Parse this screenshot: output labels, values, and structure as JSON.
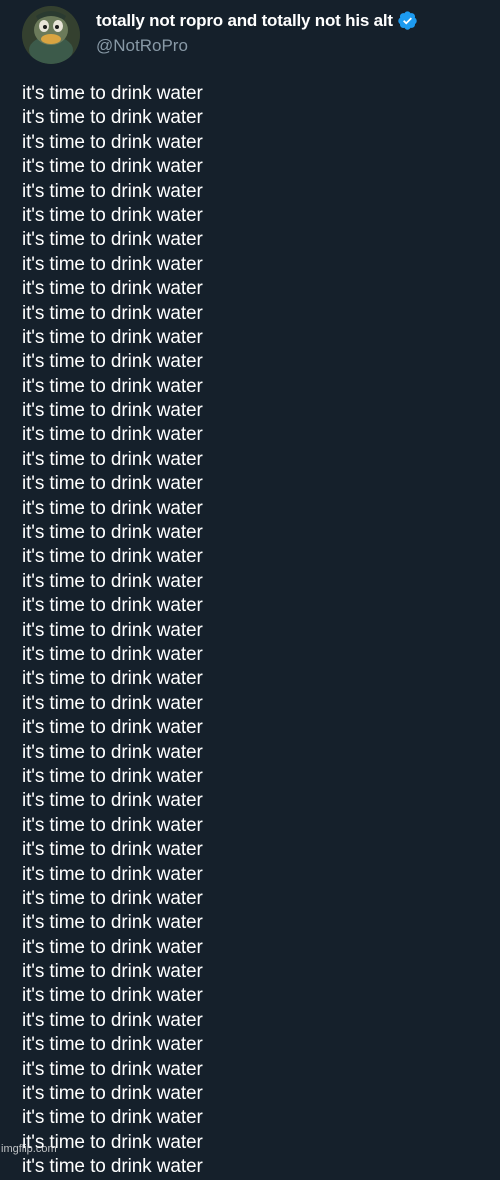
{
  "author": {
    "display_name": "totally not ropro and totally not his alt",
    "handle": "@NotRoPro",
    "verified": true,
    "avatar_icon": "duck-character-avatar"
  },
  "tweet_text_lines": [
    "it's time to drink water",
    "it's time to drink water",
    "it's time to drink water",
    "it's time to drink water",
    "it's time to drink water",
    "it's time to drink water",
    "it's time to drink water",
    "it's time to drink water",
    "it's time to drink water",
    "it's time to drink water",
    "it's time to drink water",
    "it's time to drink water",
    "it's time to drink water",
    "it's time to drink water",
    "it's time to drink water",
    "it's time to drink water",
    "it's time to drink water",
    "it's time to drink water",
    "it's time to drink water",
    "it's time to drink water",
    "it's time to drink water",
    "it's time to drink water",
    "it's time to drink water",
    "it's time to drink water",
    "it's time to drink water",
    "it's time to drink water",
    "it's time to drink water",
    "it's time to drink water",
    "it's time to drink water",
    "it's time to drink water",
    "it's time to drink water",
    "it's time to drink water",
    "it's time to drink water",
    "it's time to drink water",
    "it's time to drink water",
    "it's time to drink water",
    "it's time to drink water",
    "it's time to drink water",
    "it's time to drink water",
    "it's time to drink water",
    "it's time to drink water",
    "it's time to drink water",
    "it's time to drink water",
    "it's time to drink water",
    "it's time to drink water"
  ],
  "watermark": "imgflip.com",
  "colors": {
    "background": "#15202b",
    "text": "#ffffff",
    "handle": "#8899a6",
    "verified_badge": "#1d9bf0"
  }
}
